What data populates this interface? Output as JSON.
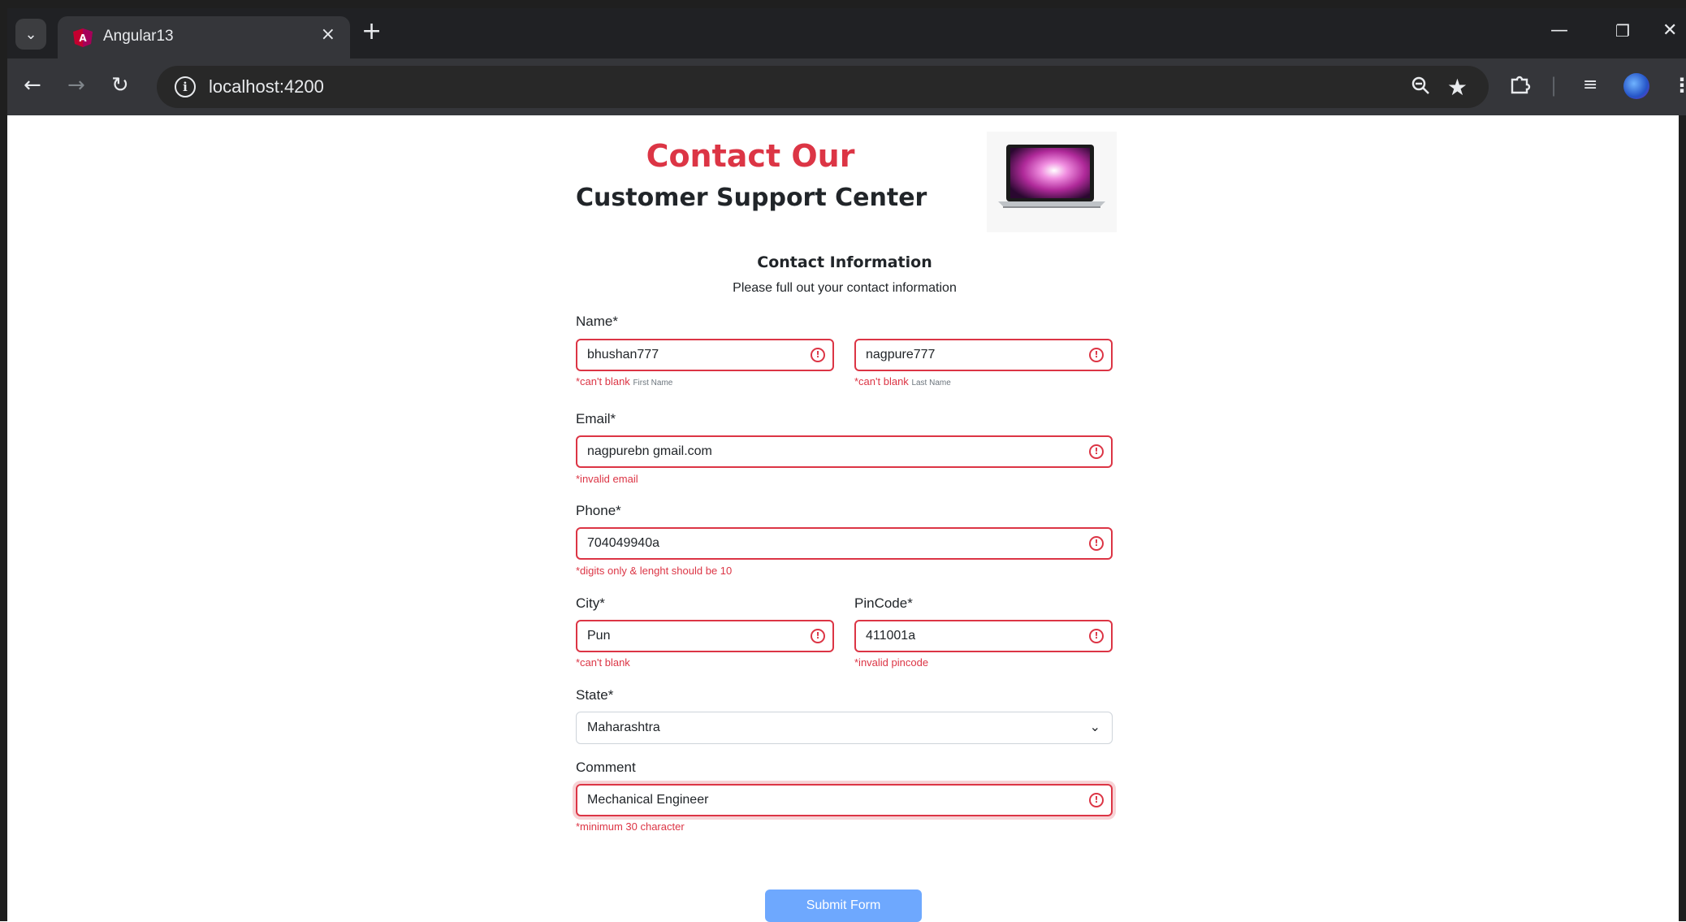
{
  "browser": {
    "tab_title": "Angular13",
    "tab_close": "×",
    "new_tab": "+",
    "url": "localhost:4200"
  },
  "header": {
    "title": "Contact Our",
    "subtitle": "Customer Support Center"
  },
  "section": {
    "title": "Contact Information",
    "subtitle": "Please full out your contact information"
  },
  "form": {
    "name_label": "Name*",
    "first_name_value": "bhushan777",
    "first_name_error": "*can't blank",
    "first_name_hint": "First Name",
    "last_name_value": "nagpure777",
    "last_name_error": "*can't blank",
    "last_name_hint": "Last Name",
    "email_label": "Email*",
    "email_value": "nagpurebn gmail.com",
    "email_error": "*invalid email",
    "phone_label": "Phone*",
    "phone_value": "704049940a",
    "phone_error": "*digits only & lenght should be 10",
    "city_label": "City*",
    "city_value": "Pun",
    "city_error": "*can't blank",
    "pincode_label": "PinCode*",
    "pincode_value": "411001a",
    "pincode_error": "*invalid pincode",
    "state_label": "State*",
    "state_value": "Maharashtra",
    "comment_label": "Comment",
    "comment_value": "Mechanical Engineer",
    "comment_error": "*minimum 30 character",
    "submit_label": "Submit Form"
  },
  "colors": {
    "error": "#dc3545",
    "submit": "#6ea8fe"
  }
}
